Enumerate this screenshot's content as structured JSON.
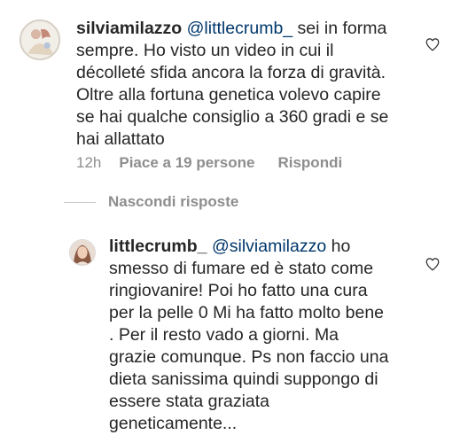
{
  "comment": {
    "username": "silviamilazzo",
    "mention": "@littlecrumb_",
    "lines": [
      " sei in forma",
      "sempre.  Ho visto un video in cui il",
      "décolleté sfida ancora la forza di gravità.",
      "Oltre alla fortuna genetica volevo capire",
      "se hai qualche consiglio a 360 gradi e se",
      "hai allattato"
    ],
    "time": "12h",
    "likes": "Piace a 19 persone",
    "reply_label": "Rispondi"
  },
  "replies_toggle": "Nascondi risposte",
  "reply": {
    "username": "littlecrumb_",
    "mention": "@silviamilazzo",
    "lines": [
      " ho",
      "smesso di fumare ed è stato come",
      "ringiovanire! Poi ho fatto una cura",
      "per la pelle 0 Mi ha fatto molto bene",
      ". Per il resto vado a giorni. Ma",
      "grazie comunque. Ps non faccio una",
      "dieta sanissima quindi suppongo di",
      "essere stata graziata",
      "geneticamente..."
    ]
  },
  "colors": {
    "text": "#262626",
    "meta": "#8e8e8e",
    "mention": "#00376b",
    "divider": "#c7c7c7"
  },
  "icons": {
    "like": "heart-outline-icon"
  }
}
